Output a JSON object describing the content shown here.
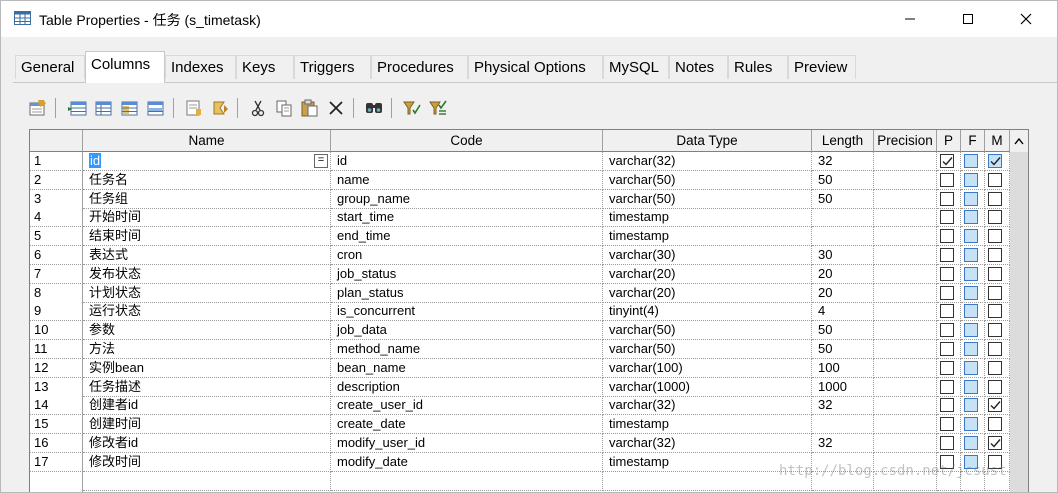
{
  "window": {
    "title": "Table Properties - 任务 (s_timetask)",
    "controls": [
      "minimize-icon",
      "maximize-icon",
      "close-icon"
    ]
  },
  "tabs": [
    {
      "label": "General",
      "active": false
    },
    {
      "label": "Columns",
      "active": true
    },
    {
      "label": "Indexes",
      "active": false
    },
    {
      "label": "Keys",
      "active": false
    },
    {
      "label": "Triggers",
      "active": false
    },
    {
      "label": "Procedures",
      "active": false
    },
    {
      "label": "Physical Options",
      "active": false
    },
    {
      "label": "MySQL",
      "active": false
    },
    {
      "label": "Notes",
      "active": false
    },
    {
      "label": "Rules",
      "active": false
    },
    {
      "label": "Preview",
      "active": false
    }
  ],
  "toolbar": {
    "icons": [
      "properties-icon",
      "insert-row-icon",
      "add-row-icon",
      "add-columns-icon",
      "delete-row-icon",
      "move-up-icon",
      "move-down-icon",
      "cut-icon",
      "copy-icon",
      "paste-icon",
      "delete-icon",
      "find-icon",
      "filter-icon",
      "clear-filter-icon"
    ]
  },
  "grid": {
    "headers": {
      "name": "Name",
      "code": "Code",
      "data_type": "Data Type",
      "length": "Length",
      "precision": "Precision",
      "p": "P",
      "f": "F",
      "m": "M"
    },
    "rows": [
      {
        "num": "1",
        "name": "id",
        "code": "id",
        "data_type": "varchar(32)",
        "length": "32",
        "p": true,
        "m": true
      },
      {
        "num": "2",
        "name": "任务名",
        "code": "name",
        "data_type": "varchar(50)",
        "length": "50",
        "p": false,
        "m": false
      },
      {
        "num": "3",
        "name": "任务组",
        "code": "group_name",
        "data_type": "varchar(50)",
        "length": "50",
        "p": false,
        "m": false
      },
      {
        "num": "4",
        "name": "开始时间",
        "code": "start_time",
        "data_type": "timestamp",
        "length": "",
        "p": false,
        "m": false
      },
      {
        "num": "5",
        "name": "结束时间",
        "code": "end_time",
        "data_type": "timestamp",
        "length": "",
        "p": false,
        "m": false
      },
      {
        "num": "6",
        "name": "表达式",
        "code": "cron",
        "data_type": "varchar(30)",
        "length": "30",
        "p": false,
        "m": false
      },
      {
        "num": "7",
        "name": "发布状态",
        "code": "job_status",
        "data_type": "varchar(20)",
        "length": "20",
        "p": false,
        "m": false
      },
      {
        "num": "8",
        "name": "计划状态",
        "code": "plan_status",
        "data_type": "varchar(20)",
        "length": "20",
        "p": false,
        "m": false
      },
      {
        "num": "9",
        "name": "运行状态",
        "code": "is_concurrent",
        "data_type": "tinyint(4)",
        "length": "4",
        "p": false,
        "m": false
      },
      {
        "num": "10",
        "name": "参数",
        "code": "job_data",
        "data_type": "varchar(50)",
        "length": "50",
        "p": false,
        "m": false
      },
      {
        "num": "11",
        "name": "方法",
        "code": "method_name",
        "data_type": "varchar(50)",
        "length": "50",
        "p": false,
        "m": false
      },
      {
        "num": "12",
        "name": "实例bean",
        "code": "bean_name",
        "data_type": "varchar(100)",
        "length": "100",
        "p": false,
        "m": false
      },
      {
        "num": "13",
        "name": "任务描述",
        "code": "description",
        "data_type": "varchar(1000)",
        "length": "1000",
        "p": false,
        "m": false
      },
      {
        "num": "14",
        "name": "创建者id",
        "code": "create_user_id",
        "data_type": "varchar(32)",
        "length": "32",
        "p": false,
        "m": true
      },
      {
        "num": "15",
        "name": "创建时间",
        "code": "create_date",
        "data_type": "timestamp",
        "length": "",
        "p": false,
        "m": false
      },
      {
        "num": "16",
        "name": "修改者id",
        "code": "modify_user_id",
        "data_type": "varchar(32)",
        "length": "32",
        "p": false,
        "m": true
      },
      {
        "num": "17",
        "name": "修改时间",
        "code": "modify_date",
        "data_type": "timestamp",
        "length": "",
        "p": false,
        "m": false
      }
    ],
    "selected_row": 1,
    "editor_button_label": "="
  },
  "watermark": "http://blog.csdn.net/jcsust"
}
